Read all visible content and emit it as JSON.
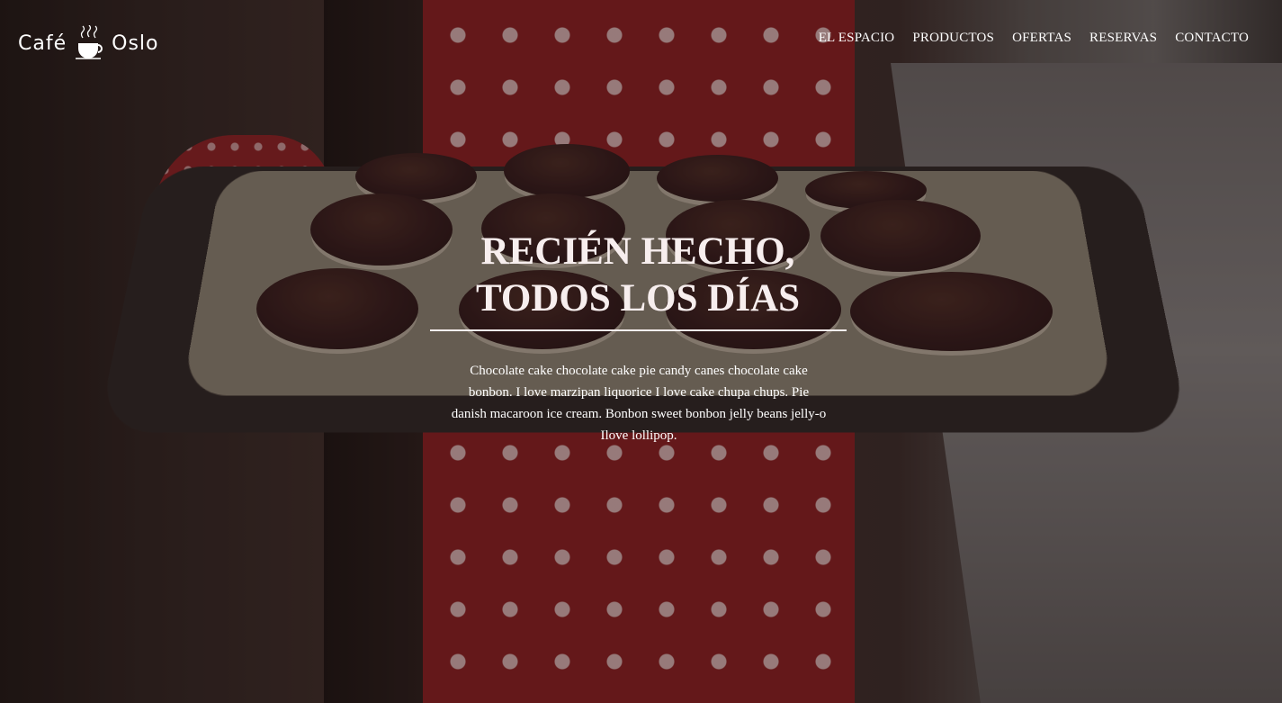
{
  "brand": {
    "left": "Café",
    "right": "Oslo",
    "icon": "coffee-cup-icon"
  },
  "nav": {
    "items": [
      {
        "label": "EL ESPACIO"
      },
      {
        "label": "PRODUCTOS"
      },
      {
        "label": "OFERTAS"
      },
      {
        "label": "RESERVAS"
      },
      {
        "label": "CONTACTO"
      }
    ]
  },
  "hero": {
    "headline_line1": "RECIÉN HECHO,",
    "headline_line2": "TODOS LOS DÍAS",
    "lead": "Chocolate cake chocolate cake pie candy canes chocolate cake bonbon. I love marzipan liquorice I love cake chupa chups. Pie danish macaroon ice cream. Bonbon sweet bonbon jelly beans jelly-o Ilove lollipop."
  },
  "colors": {
    "text": "#ffffff",
    "apron": "#8a1d1f",
    "overlay": "#1e1210"
  }
}
